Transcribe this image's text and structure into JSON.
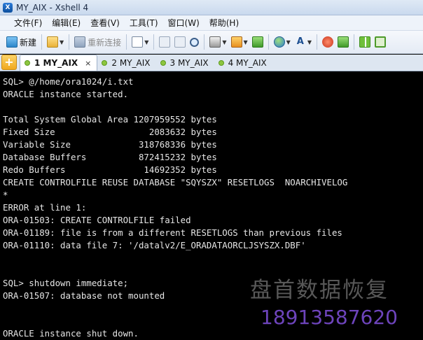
{
  "window": {
    "title": "MY_AIX - Xshell 4"
  },
  "menu": {
    "items": [
      "文件(F)",
      "编辑(E)",
      "查看(V)",
      "工具(T)",
      "窗口(W)",
      "帮助(H)"
    ]
  },
  "toolbar": {
    "new_label": "新建",
    "reconnect_label": "重新连接"
  },
  "tabs": [
    {
      "label": "1 MY_AIX",
      "active": true
    },
    {
      "label": "2 MY_AIX",
      "active": false
    },
    {
      "label": "3 MY_AIX",
      "active": false
    },
    {
      "label": "4 MY_AIX",
      "active": false
    }
  ],
  "tab_close_glyph": "×",
  "terminal_lines": [
    "SQL> @/home/ora1024/i.txt",
    "ORACLE instance started.",
    "",
    "Total System Global Area 1207959552 bytes",
    "Fixed Size                  2083632 bytes",
    "Variable Size             318768336 bytes",
    "Database Buffers          872415232 bytes",
    "Redo Buffers               14692352 bytes",
    "CREATE CONTROLFILE REUSE DATABASE \"SQYSZX\" RESETLOGS  NOARCHIVELOG",
    "*",
    "ERROR at line 1:",
    "ORA-01503: CREATE CONTROLFILE failed",
    "ORA-01189: file is from a different RESETLOGS than previous files",
    "ORA-01110: data file 7: '/datalv2/E_ORADATAORCLJSYSZX.DBF'",
    "",
    "",
    "SQL> shutdown immediate;",
    "ORA-01507: database not mounted",
    "",
    "",
    "ORACLE instance shut down."
  ],
  "watermark": {
    "company": "盘首数据恢复",
    "phone": "18913587620"
  },
  "colors": {
    "terminal_bg": "#000000",
    "terminal_fg": "#e6e6e6",
    "phone": "#8050dc"
  }
}
